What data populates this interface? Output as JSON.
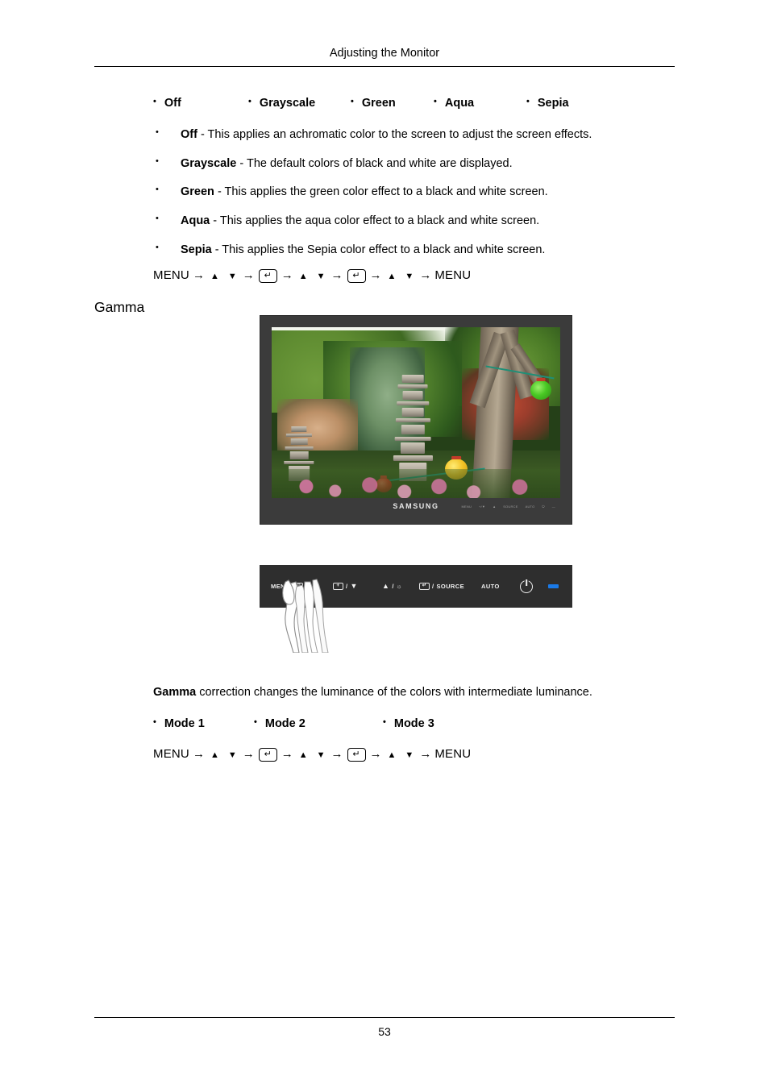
{
  "document": {
    "header_title": "Adjusting the Monitor",
    "page_number": "53"
  },
  "color_effect_options": {
    "bullet": "•",
    "items": [
      {
        "label": "Off"
      },
      {
        "label": "Grayscale"
      },
      {
        "label": "Green"
      },
      {
        "label": "Aqua"
      },
      {
        "label": "Sepia"
      }
    ]
  },
  "color_effect_descriptions": [
    {
      "term": "Off",
      "text": " - This applies an achromatic color to the screen to adjust the screen effects."
    },
    {
      "term": "Grayscale",
      "text": " - The default colors of black and white are displayed."
    },
    {
      "term": "Green",
      "text": " - This applies the green color effect to a black and white screen."
    },
    {
      "term": "Aqua",
      "text": " - This applies the aqua color effect to a black and white screen."
    },
    {
      "term": "Sepia",
      "text": " - This applies the Sepia color effect to a black and white screen."
    }
  ],
  "menu_path": {
    "start": "MENU",
    "end": "MENU",
    "arrow": "→",
    "up": "▲",
    "down": "▼",
    "enter": "↵"
  },
  "gamma_section": {
    "heading": "Gamma",
    "description_term": "Gamma",
    "description_text": " correction changes the luminance of the colors with intermediate luminance.",
    "mode_bullet": "•",
    "modes": [
      {
        "label": "Mode 1"
      },
      {
        "label": "Mode 2"
      },
      {
        "label": "Mode 3"
      }
    ]
  },
  "monitor_illustration": {
    "brand_logo": "SAMSUNG",
    "bezel_icon_labels": [
      "MENU",
      "+/▼",
      "▲",
      "SOURCE",
      "AUTO",
      "⏻",
      "—"
    ],
    "bezel_color": "#3b3b3b"
  },
  "control_panel": {
    "background_color": "#2e2e2e",
    "led_color": "#1a7ae8",
    "buttons": [
      {
        "name": "menu",
        "label": "MENU",
        "key": "▭"
      },
      {
        "name": "minus-down",
        "label": "",
        "key": "+",
        "separator": "/",
        "arrow": "▼"
      },
      {
        "name": "up-brightness",
        "label": "",
        "arrow": "▲",
        "separator": "/",
        "key": "☼"
      },
      {
        "name": "enter-source",
        "label": "SOURCE",
        "key": "↵",
        "separator": "/"
      },
      {
        "name": "auto",
        "label": "AUTO"
      },
      {
        "name": "power",
        "label": "⏻"
      },
      {
        "name": "power-led",
        "label": "—"
      }
    ]
  }
}
